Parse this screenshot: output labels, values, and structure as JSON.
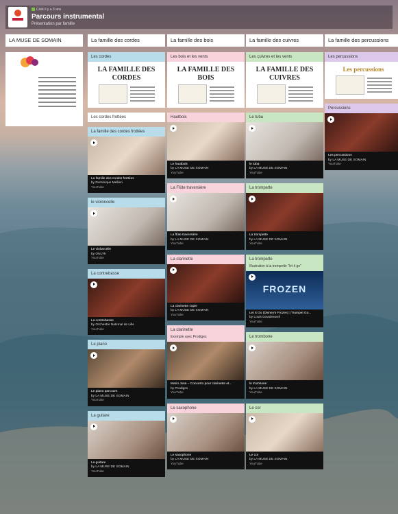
{
  "header": {
    "meta": "Créé il y a 3 ans",
    "title": "Parcours instrumental",
    "subtitle": "Présentation par famille"
  },
  "columns": [
    {
      "title": "LA MUSE DE SOMAIN",
      "cards": []
    },
    {
      "title": "La famille des cordes",
      "cards": [
        {
          "type": "poster",
          "color": "blue",
          "head": "Les cordes",
          "poster_title": "LA FAMILLE DES CORDES"
        },
        {
          "type": "label",
          "color": "white",
          "head": "Les cordes frottées"
        },
        {
          "type": "video",
          "color": "blue",
          "head": "La famille des cordes frottées",
          "vtitle": "La famille des cordes frottées",
          "vauthor": "by Dominique Mellieri",
          "vsrc": "YouTube"
        },
        {
          "type": "video",
          "color": "blue",
          "head": "le violoncelle",
          "vtitle": "Le violoncelle",
          "vauthor": "by ONLYk",
          "vsrc": "YouTube"
        },
        {
          "type": "video",
          "color": "blue",
          "head": "La contrebasse",
          "vtitle": "La contrebasse",
          "vauthor": "by Orchestre National de Lille",
          "vsrc": "YouTube"
        },
        {
          "type": "video",
          "color": "blue",
          "head": "Le piano",
          "vtitle": "Le piano parcours",
          "vauthor": "by LA MUSE DE SOMAIN",
          "vsrc": "YouTube"
        },
        {
          "type": "video",
          "color": "blue",
          "head": "La guitare",
          "vtitle": "La guitare",
          "vauthor": "by LA MUSE DE SOMAIN",
          "vsrc": "YouTube"
        }
      ]
    },
    {
      "title": "La famille des bois",
      "cards": [
        {
          "type": "poster",
          "color": "pink",
          "head": "Les bois et les vents",
          "poster_title": "LA FAMILLE DES BOIS"
        },
        {
          "type": "video",
          "color": "pink",
          "head": "Hautbois",
          "vtitle": "Le hautbois",
          "vauthor": "by LA MUSE DE SOMAIN",
          "vsrc": "YouTube"
        },
        {
          "type": "video",
          "color": "pink",
          "head": "La Flûte traversière",
          "vtitle": "La flûte traversière",
          "vauthor": "by LA MUSE DE SOMAIN",
          "vsrc": "YouTube"
        },
        {
          "type": "video",
          "color": "pink",
          "head": "La clarinette",
          "vtitle": "La clarinette copie",
          "vauthor": "by LA MUSE DE SOMAIN",
          "vsrc": "YouTube"
        },
        {
          "type": "video",
          "color": "pink",
          "head": "La clarinette",
          "note": "Exemple avec Prodiges",
          "vtitle": "Mario Jose – Concerto pour clarinette et...",
          "vauthor": "by Prodiges",
          "vsrc": "YouTube"
        },
        {
          "type": "video",
          "color": "pink",
          "head": "Le saxophone",
          "vtitle": "Le saxophone",
          "vauthor": "by LA MUSE DE SOMAIN",
          "vsrc": "YouTube"
        }
      ]
    },
    {
      "title": "La famille des cuivres",
      "cards": [
        {
          "type": "poster",
          "color": "green",
          "head": "Les cuivres et les vents",
          "poster_title": "LA FAMILLE DES CUIVRES"
        },
        {
          "type": "video",
          "color": "green",
          "head": "Le tuba",
          "vtitle": "le tuba",
          "vauthor": "by LA MUSE DE SOMAIN",
          "vsrc": "YouTube"
        },
        {
          "type": "video",
          "color": "green",
          "head": "La trompette",
          "vtitle": "La trompette",
          "vauthor": "by LA MUSE DE SOMAIN",
          "vsrc": "YouTube"
        },
        {
          "type": "video",
          "color": "green",
          "head": "La trompette",
          "note": "Illustration à la trompette \"let it go\"",
          "vtitle": "Let It Go (Disney's Frozen) | Trumpet Go...",
          "vauthor": "by Louis Dowdeswell",
          "vsrc": "YouTube",
          "overlay": "FROZEN"
        },
        {
          "type": "video",
          "color": "green",
          "head": "Le trombone",
          "vtitle": "le trombone",
          "vauthor": "by LA MUSE DE SOMAIN",
          "vsrc": "YouTube"
        },
        {
          "type": "video",
          "color": "green",
          "head": "Le cor",
          "vtitle": "Le cor",
          "vauthor": "by LA MUSE DE SOMAIN",
          "vsrc": "YouTube"
        }
      ]
    },
    {
      "title": "La famille des percussions",
      "cards": [
        {
          "type": "poster",
          "color": "purple",
          "head": "Les percussions",
          "poster_title": "Les percussions",
          "gold": true
        },
        {
          "type": "video",
          "color": "purple",
          "head": "Percussions",
          "vtitle": "Les percussions",
          "vauthor": "by LA MUSE DE SOMAIN",
          "vsrc": "YouTube"
        }
      ]
    }
  ],
  "colors": {
    "blue": "#b8dcea",
    "pink": "#f8d3dc",
    "green": "#c9e6c3",
    "purple": "#dbc8ea"
  }
}
